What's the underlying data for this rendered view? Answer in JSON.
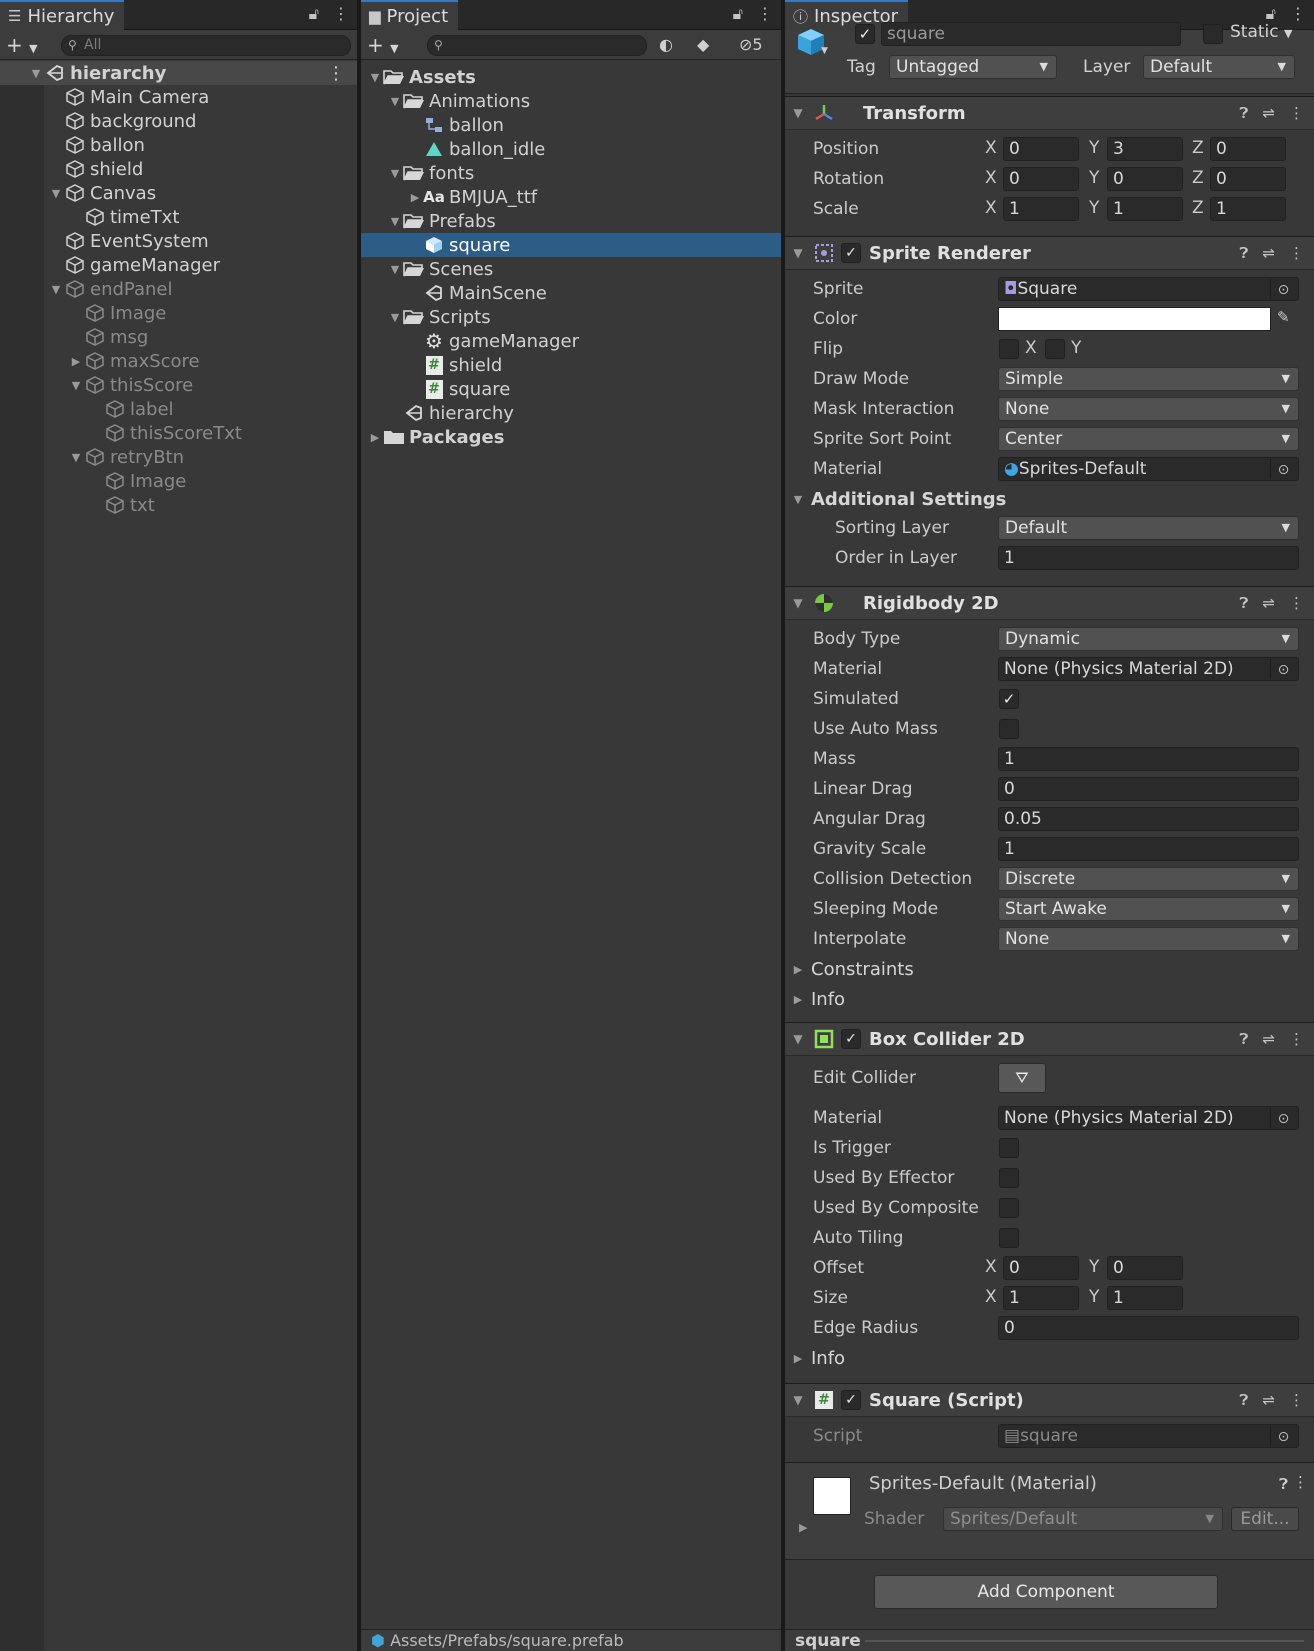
{
  "hierarchy": {
    "tab_title": "Hierarchy",
    "search_placeholder": "All",
    "items": [
      {
        "label": "hierarchy",
        "depth": 0,
        "kind": "scene",
        "expanded": true
      },
      {
        "label": "Main Camera",
        "depth": 1
      },
      {
        "label": "background",
        "depth": 1
      },
      {
        "label": "ballon",
        "depth": 1
      },
      {
        "label": "shield",
        "depth": 1
      },
      {
        "label": "Canvas",
        "depth": 1,
        "expanded": true
      },
      {
        "label": "timeTxt",
        "depth": 2
      },
      {
        "label": "EventSystem",
        "depth": 1
      },
      {
        "label": "gameManager",
        "depth": 1
      },
      {
        "label": "endPanel",
        "depth": 1,
        "expanded": true,
        "inactive": true
      },
      {
        "label": "Image",
        "depth": 2,
        "inactive": true
      },
      {
        "label": "msg",
        "depth": 2,
        "inactive": true
      },
      {
        "label": "maxScore",
        "depth": 2,
        "collapsed": true,
        "inactive": true
      },
      {
        "label": "thisScore",
        "depth": 2,
        "expanded": true,
        "inactive": true
      },
      {
        "label": "label",
        "depth": 3,
        "inactive": true
      },
      {
        "label": "thisScoreTxt",
        "depth": 3,
        "inactive": true
      },
      {
        "label": "retryBtn",
        "depth": 2,
        "expanded": true,
        "inactive": true
      },
      {
        "label": "Image",
        "depth": 3,
        "inactive": true
      },
      {
        "label": "txt",
        "depth": 3,
        "inactive": true
      }
    ]
  },
  "project": {
    "tab_title": "Project",
    "hidden_count": "5",
    "items": [
      {
        "label": "Assets",
        "depth": 0,
        "icon": "folder-open",
        "bold": true,
        "expanded": true
      },
      {
        "label": "Animations",
        "depth": 1,
        "icon": "folder-open",
        "expanded": true
      },
      {
        "label": "ballon",
        "depth": 2,
        "icon": "animator"
      },
      {
        "label": "ballon_idle",
        "depth": 2,
        "icon": "anim-clip"
      },
      {
        "label": "fonts",
        "depth": 1,
        "icon": "folder-open",
        "expanded": true
      },
      {
        "label": "BMJUA_ttf",
        "depth": 2,
        "icon": "font",
        "collapsed": true
      },
      {
        "label": "Prefabs",
        "depth": 1,
        "icon": "folder-open",
        "expanded": true
      },
      {
        "label": "square",
        "depth": 2,
        "icon": "prefab",
        "selected": true
      },
      {
        "label": "Scenes",
        "depth": 1,
        "icon": "folder-open",
        "expanded": true
      },
      {
        "label": "MainScene",
        "depth": 2,
        "icon": "scene"
      },
      {
        "label": "Scripts",
        "depth": 1,
        "icon": "folder-open",
        "expanded": true
      },
      {
        "label": "gameManager",
        "depth": 2,
        "icon": "gear"
      },
      {
        "label": "shield",
        "depth": 2,
        "icon": "script"
      },
      {
        "label": "square",
        "depth": 2,
        "icon": "script"
      },
      {
        "label": "hierarchy",
        "depth": 1,
        "icon": "scene"
      },
      {
        "label": "Packages",
        "depth": 0,
        "icon": "folder",
        "bold": true,
        "collapsed": true
      }
    ],
    "status_path": "Assets/Prefabs/square.prefab"
  },
  "inspector": {
    "tab_title": "Inspector",
    "object_name": "square",
    "static_label": "Static",
    "tag_label": "Tag",
    "tag_value": "Untagged",
    "layer_label": "Layer",
    "layer_value": "Default",
    "transform": {
      "title": "Transform",
      "position_label": "Position",
      "position": {
        "x": "0",
        "y": "3",
        "z": "0"
      },
      "rotation_label": "Rotation",
      "rotation": {
        "x": "0",
        "y": "0",
        "z": "0"
      },
      "scale_label": "Scale",
      "scale": {
        "x": "1",
        "y": "1",
        "z": "1"
      }
    },
    "sprite_renderer": {
      "title": "Sprite Renderer",
      "sprite_label": "Sprite",
      "sprite_value": "Square",
      "color_label": "Color",
      "color_value": "#ffffff",
      "flip_label": "Flip",
      "flip_x": "X",
      "flip_y": "Y",
      "draw_mode_label": "Draw Mode",
      "draw_mode_value": "Simple",
      "mask_label": "Mask Interaction",
      "mask_value": "None",
      "sort_point_label": "Sprite Sort Point",
      "sort_point_value": "Center",
      "material_label": "Material",
      "material_value": "Sprites-Default",
      "additional_label": "Additional Settings",
      "sorting_layer_label": "Sorting Layer",
      "sorting_layer_value": "Default",
      "order_label": "Order in Layer",
      "order_value": "1"
    },
    "rigidbody": {
      "title": "Rigidbody 2D",
      "body_type_label": "Body Type",
      "body_type_value": "Dynamic",
      "material_label": "Material",
      "material_value": "None (Physics Material 2D)",
      "simulated_label": "Simulated",
      "simulated_checked": true,
      "auto_mass_label": "Use Auto Mass",
      "mass_label": "Mass",
      "mass_value": "1",
      "linear_drag_label": "Linear Drag",
      "linear_drag_value": "0",
      "angular_drag_label": "Angular Drag",
      "angular_drag_value": "0.05",
      "gravity_label": "Gravity Scale",
      "gravity_value": "1",
      "collision_label": "Collision Detection",
      "collision_value": "Discrete",
      "sleeping_label": "Sleeping Mode",
      "sleeping_value": "Start Awake",
      "interpolate_label": "Interpolate",
      "interpolate_value": "None",
      "constraints_label": "Constraints",
      "info_label": "Info"
    },
    "box_collider": {
      "title": "Box Collider 2D",
      "edit_label": "Edit Collider",
      "material_label": "Material",
      "material_value": "None (Physics Material 2D)",
      "trigger_label": "Is Trigger",
      "effector_label": "Used By Effector",
      "composite_label": "Used By Composite",
      "tiling_label": "Auto Tiling",
      "offset_label": "Offset",
      "offset": {
        "x": "0",
        "y": "0"
      },
      "size_label": "Size",
      "size": {
        "x": "1",
        "y": "1"
      },
      "edge_label": "Edge Radius",
      "edge_value": "0",
      "info_label": "Info"
    },
    "script": {
      "title": "Square (Script)",
      "script_label": "Script",
      "script_value": "square"
    },
    "material_preview": {
      "title": "Sprites-Default (Material)",
      "shader_label": "Shader",
      "shader_value": "Sprites/Default",
      "edit_label": "Edit..."
    },
    "add_component_label": "Add Component",
    "footer_label": "square"
  }
}
